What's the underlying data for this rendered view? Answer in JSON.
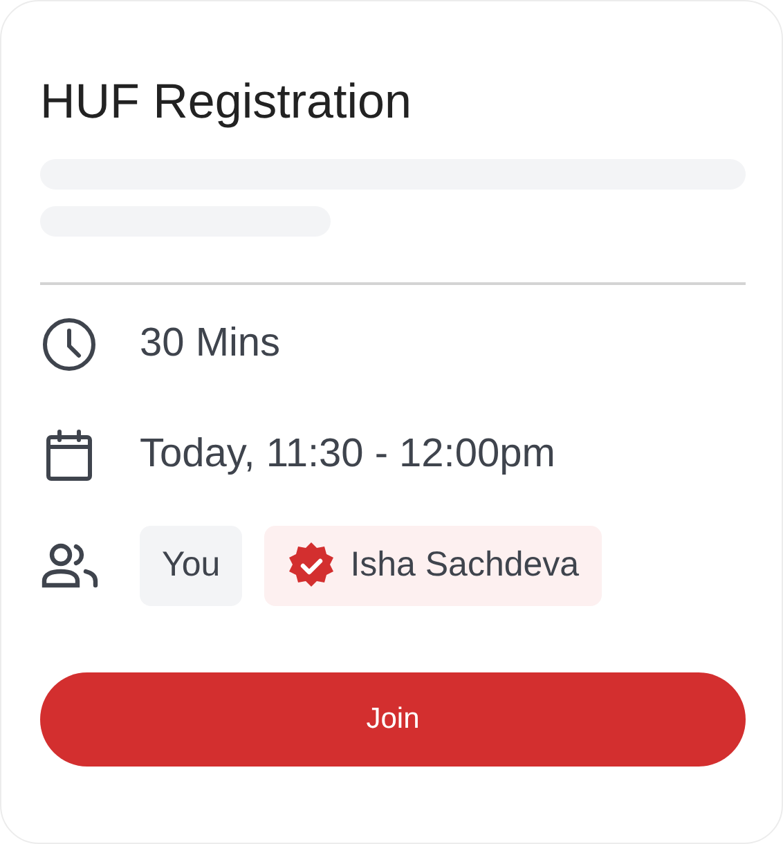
{
  "title": "HUF Registration",
  "details": [
    {
      "kind": "duration",
      "text": "30 Mins"
    },
    {
      "kind": "time",
      "text": "Today, 11:30 - 12:00pm"
    }
  ],
  "participants": [
    {
      "kind": "plain",
      "name": "You"
    },
    {
      "kind": "verified",
      "name": "Isha Sachdeva"
    }
  ],
  "button": "Join"
}
